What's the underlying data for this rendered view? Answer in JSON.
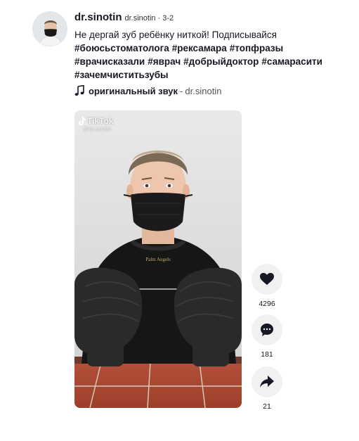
{
  "author": {
    "name": "dr.sinotin",
    "handle": "dr.sinotin",
    "separator": "·",
    "date": "3-2"
  },
  "caption": {
    "text": "Не дергай зуб ребёнку ниткой! Подписывайся",
    "hashtags": [
      "#боюсьстоматолога",
      "#рексамара",
      "#топфразы",
      "#врачисказали",
      "#яврач",
      "#добрыйдоктор",
      "#самарасити",
      "#зачемчиститьзубы"
    ]
  },
  "sound": {
    "icon": "music-note-icon",
    "title": "оригинальный звук",
    "separator": "-",
    "author": "dr.sinotin"
  },
  "video": {
    "watermark_logo": "TikTok",
    "watermark_handle": "@dr.sinotin"
  },
  "actions": {
    "likes": {
      "icon": "heart-icon",
      "count": "4296"
    },
    "comments": {
      "icon": "comment-icon",
      "count": "181"
    },
    "shares": {
      "icon": "share-icon",
      "count": "21"
    }
  },
  "colors": {
    "text": "#161823",
    "action_bg": "#f1f1f2",
    "glove": "#2a2a2a",
    "floor_tile": "#a8452f"
  }
}
